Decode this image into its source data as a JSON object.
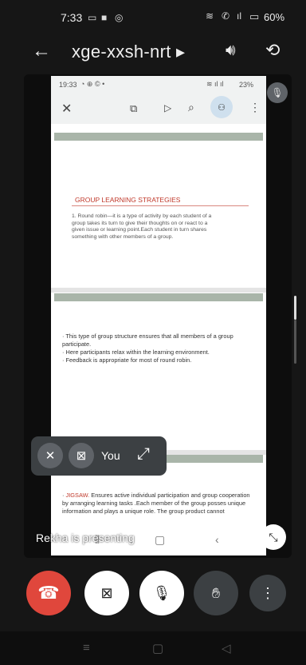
{
  "status_bar": {
    "time": "7:33",
    "battery": "60%"
  },
  "meeting": {
    "code": "xge-xxsh-nrt ▸"
  },
  "shared_screen": {
    "status_time": "19:33",
    "status_right": "23%",
    "slide1": {
      "title": "GROUP LEARNING STRATEGIES",
      "body": "1. Round robin—it is a type of activity by each student of a group  takes its turn to give their thoughts on or react to a given issue or learning point.Each student in turn shares something with other members of a group."
    },
    "slide2": {
      "bullets": [
        "This type of group structure ensures that all members of a group participate.",
        "Here  participants relax within the learning environment.",
        "Feedback is appropriate for most of round robin."
      ]
    },
    "slide3": {
      "lead": "JIGSAW.",
      "body": " Ensures active individual participation and group cooperation by arranging learning tasks .Each member of the group posses unique information and plays a unique role.  The group product cannot"
    }
  },
  "self_view": {
    "label": "You"
  },
  "presenter": {
    "text": "Rekha is presenting"
  },
  "icons": {
    "back": "arrow-left-icon",
    "volume": "speaker-icon",
    "switch_camera": "switch-camera-icon",
    "end_call": "phone-hangup-icon",
    "video_off": "video-off-icon",
    "mic_off": "mic-off-icon",
    "raise_hand": "hand-icon",
    "more": "more-vert-icon"
  },
  "colors": {
    "end_call": "#e0473c",
    "slide_accent": "#c0392b",
    "background": "#161616"
  }
}
